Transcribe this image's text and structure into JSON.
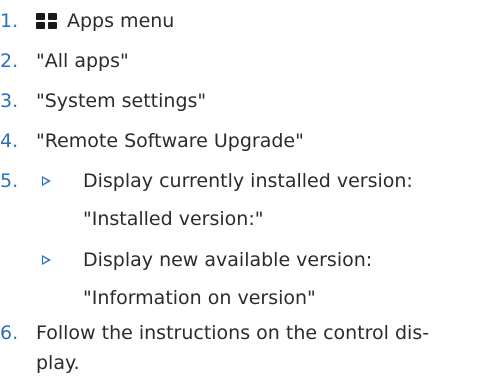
{
  "steps": [
    {
      "num": "1.",
      "text": "Apps menu",
      "icon": "apps-grid-icon"
    },
    {
      "num": "2.",
      "text": "\"All apps\""
    },
    {
      "num": "3.",
      "text": "\"System settings\""
    },
    {
      "num": "4.",
      "text": "\"Remote Software Upgrade\""
    },
    {
      "num": "5.",
      "bullets": [
        {
          "line1": "Display currently installed version:",
          "line2": "\"Installed version:\""
        },
        {
          "line1": "Display new available version:",
          "line2": "\"Information on version\""
        }
      ]
    },
    {
      "num": "6.",
      "line1": "Follow the instructions on the control dis-",
      "line2": "play."
    }
  ],
  "colors": {
    "number": "#2f6fb5",
    "text": "#2b2b2b",
    "bullet": "#2f6fb5"
  }
}
